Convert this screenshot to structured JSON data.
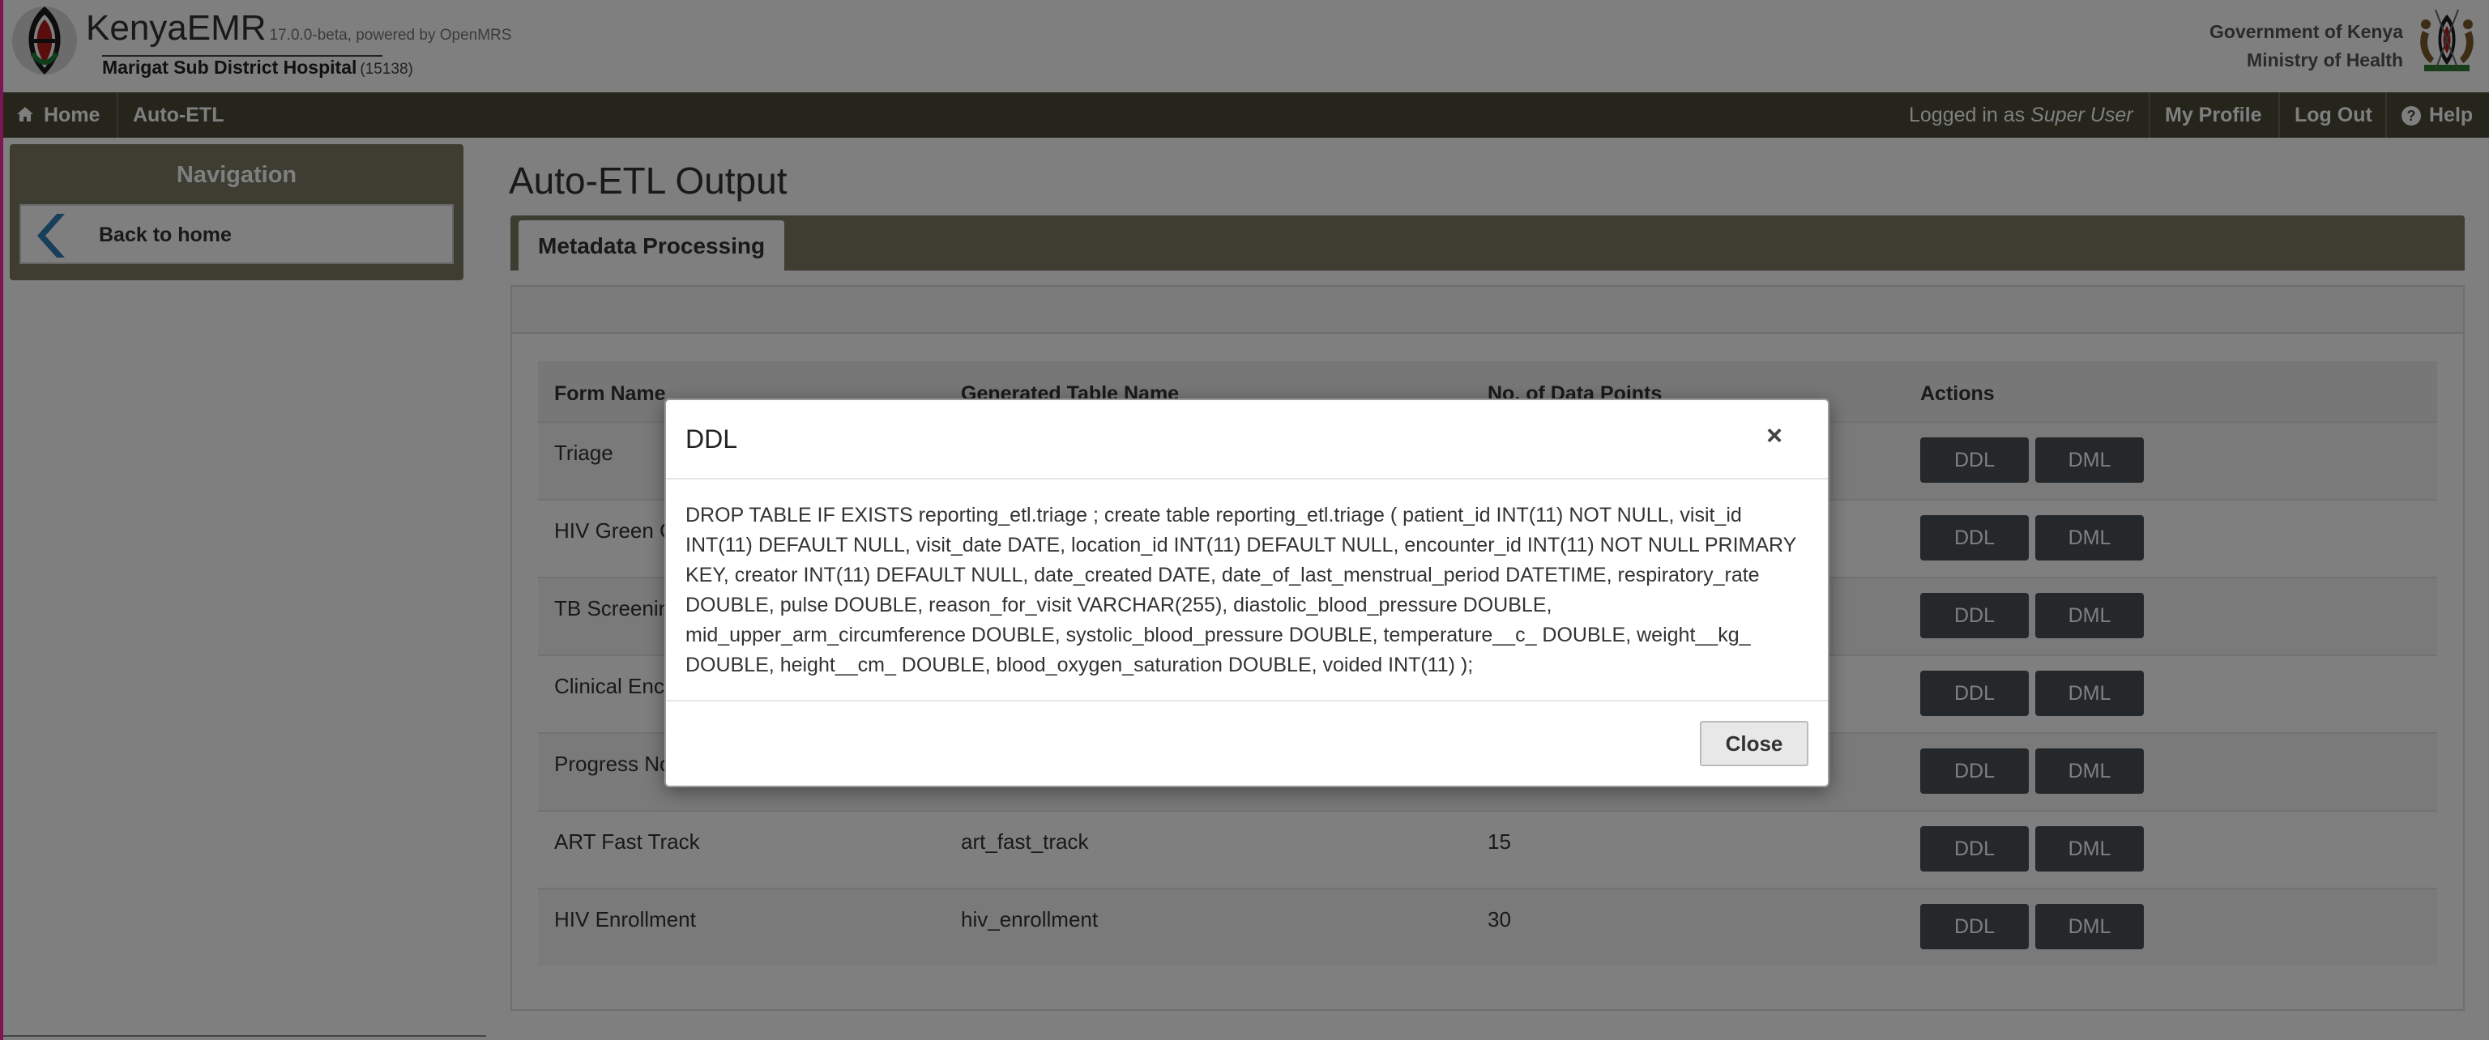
{
  "header": {
    "app_name": "KenyaEMR",
    "version": "17.0.0-beta, powered by OpenMRS",
    "facility": "Marigat Sub District Hospital",
    "facility_code": "(15138)",
    "gov_line1": "Government of Kenya",
    "gov_line2": "Ministry of Health"
  },
  "topnav": {
    "home": "Home",
    "app": "Auto-ETL",
    "logged_in_prefix": "Logged in as",
    "user": "Super User",
    "my_profile": "My Profile",
    "log_out": "Log Out",
    "help": "Help"
  },
  "sidebar": {
    "title": "Navigation",
    "back": "Back to home"
  },
  "main": {
    "title": "Auto-ETL Output",
    "tab": "Metadata Processing",
    "columns": [
      "Form Name",
      "Generated Table Name",
      "No. of Data Points",
      "Actions"
    ],
    "rows": [
      {
        "form": "Triage",
        "table": "",
        "points": ""
      },
      {
        "form": "HIV Green C",
        "table": "",
        "points": ""
      },
      {
        "form": "TB Screenin",
        "table": "",
        "points": ""
      },
      {
        "form": "Clinical Enco",
        "table": "",
        "points": ""
      },
      {
        "form": "Progress No",
        "table": "",
        "points": ""
      },
      {
        "form": "ART Fast Track",
        "table": "art_fast_track",
        "points": "15"
      },
      {
        "form": "HIV Enrollment",
        "table": "hiv_enrollment",
        "points": "30"
      }
    ],
    "ddl_label": "DDL",
    "dml_label": "DML"
  },
  "modal": {
    "title": "DDL",
    "close_x": "×",
    "body": "DROP TABLE IF EXISTS reporting_etl.triage ; create table reporting_etl.triage ( patient_id INT(11) NOT NULL, visit_id INT(11) DEFAULT NULL, visit_date DATE, location_id INT(11) DEFAULT NULL, encounter_id INT(11) NOT NULL PRIMARY KEY, creator INT(11) DEFAULT NULL, date_created DATE, date_of_last_menstrual_period DATETIME, respiratory_rate DOUBLE, pulse DOUBLE, reason_for_visit VARCHAR(255), diastolic_blood_pressure DOUBLE, mid_upper_arm_circumference DOUBLE, systolic_blood_pressure DOUBLE, temperature__c_ DOUBLE, weight__kg_ DOUBLE, height__cm_ DOUBLE, blood_oxygen_saturation DOUBLE, voided INT(11) );",
    "close_button": "Close"
  },
  "icons": {
    "home": "home-icon",
    "help": "help-icon",
    "back": "chevron-left-icon",
    "logo": "kenyaemr-shield-logo",
    "coat": "kenya-coat-of-arms"
  },
  "colors": {
    "nav_bar": "#4a4a38",
    "panel": "#7a7a62",
    "action_button": "#495057",
    "back_chevron": "#2f7fb3"
  }
}
